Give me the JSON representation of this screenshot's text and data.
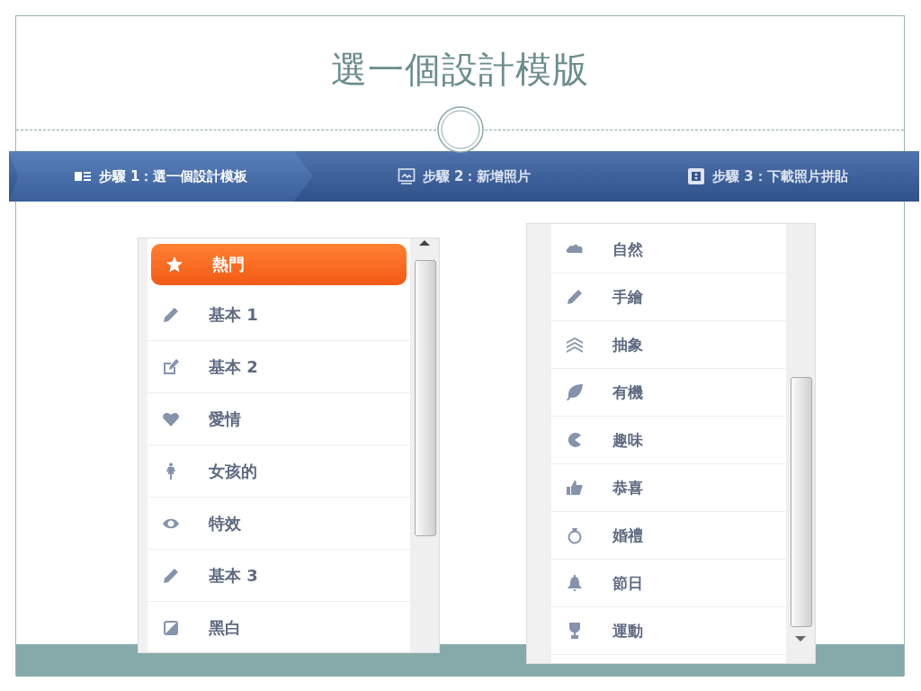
{
  "slide": {
    "title": "選一個設計模版"
  },
  "steps": [
    {
      "label": "步驟 1：選一個設計模板",
      "selected": true
    },
    {
      "label": "步驟 2：新增照片",
      "selected": false
    },
    {
      "label": "步驟 3：下載照片拼貼",
      "selected": false
    }
  ],
  "left_list": [
    {
      "label": "熱門",
      "selected": true
    },
    {
      "label": "基本 1",
      "selected": false
    },
    {
      "label": "基本 2",
      "selected": false
    },
    {
      "label": "愛情",
      "selected": false
    },
    {
      "label": "女孩的",
      "selected": false
    },
    {
      "label": "特效",
      "selected": false
    },
    {
      "label": "基本 3",
      "selected": false
    },
    {
      "label": "黑白",
      "selected": false
    }
  ],
  "right_list": [
    {
      "label": "自然",
      "selected": false
    },
    {
      "label": "手繪",
      "selected": false
    },
    {
      "label": "抽象",
      "selected": false
    },
    {
      "label": "有機",
      "selected": false
    },
    {
      "label": "趣味",
      "selected": false
    },
    {
      "label": "恭喜",
      "selected": false
    },
    {
      "label": "婚禮",
      "selected": false
    },
    {
      "label": "節日",
      "selected": false
    },
    {
      "label": "運動",
      "selected": false
    }
  ]
}
